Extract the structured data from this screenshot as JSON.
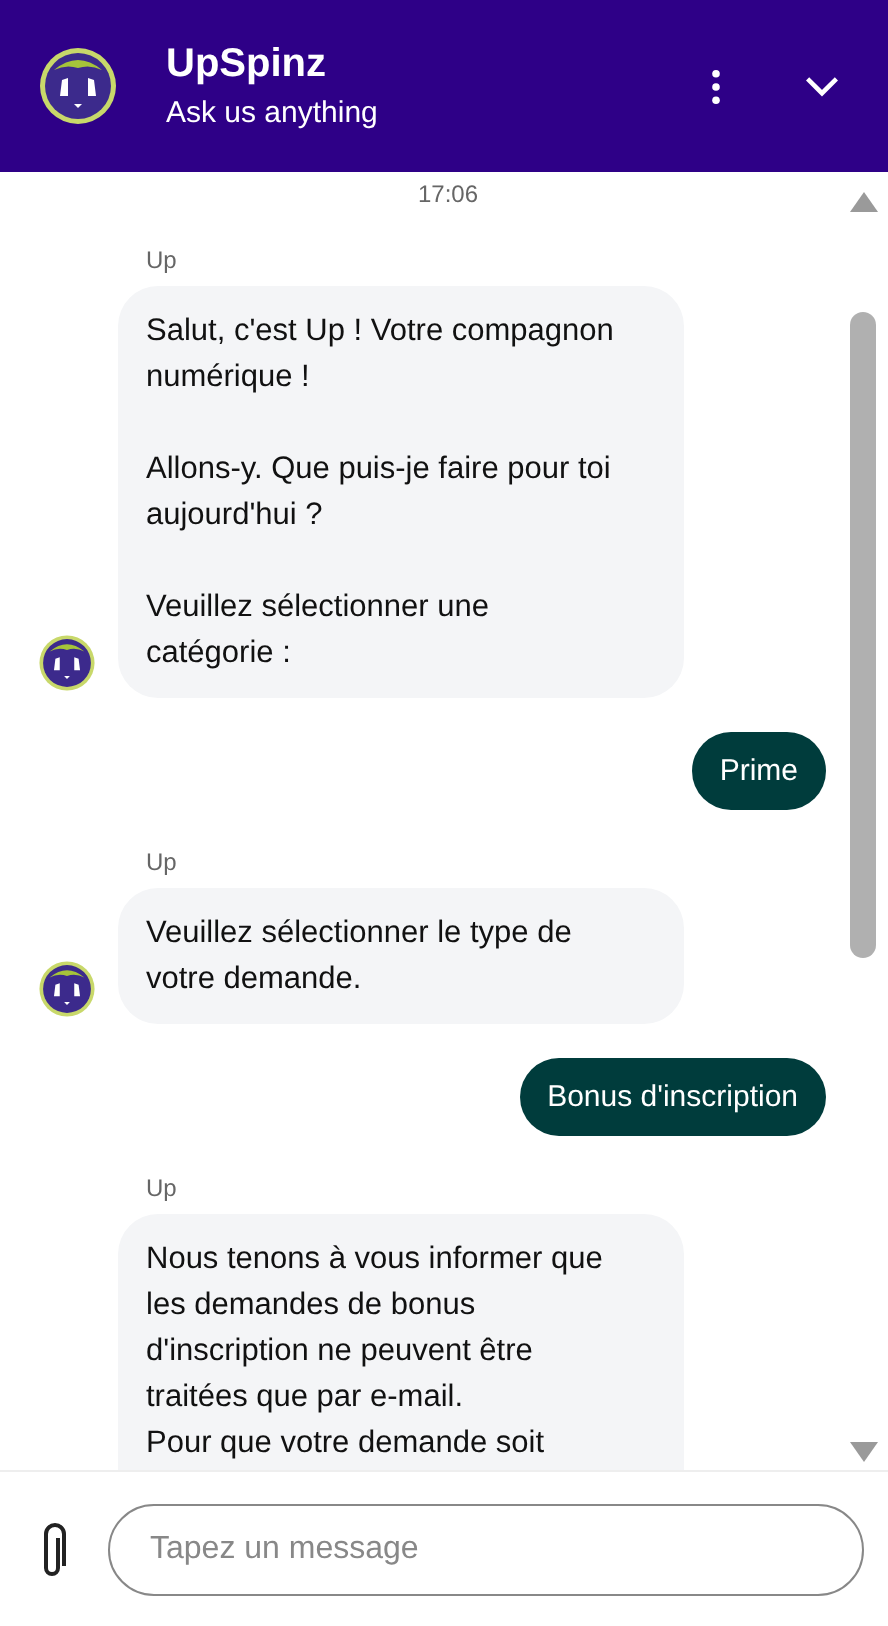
{
  "header": {
    "title": "UpSpinz",
    "subtitle": "Ask us anything"
  },
  "timestamp": "17:06",
  "messages": [
    {
      "kind": "bot",
      "sender": "Up",
      "text": "Salut, c'est Up ! Votre compagnon\nnumérique !\n\nAllons-y. Que puis-je faire pour toi\naujourd'hui ?\n\nVeuillez sélectionner une\ncatégorie :"
    },
    {
      "kind": "user",
      "text": "Prime"
    },
    {
      "kind": "bot",
      "sender": "Up",
      "text": "Veuillez sélectionner le type de\nvotre demande."
    },
    {
      "kind": "user",
      "text": "Bonus d'inscription"
    },
    {
      "kind": "bot",
      "sender": "Up",
      "text": "Nous tenons à vous informer que\nles demandes de bonus\nd'inscription ne peuvent être\ntraitées que par e-mail.\nPour que votre demande soit"
    }
  ],
  "composer": {
    "placeholder": "Tapez un message"
  }
}
